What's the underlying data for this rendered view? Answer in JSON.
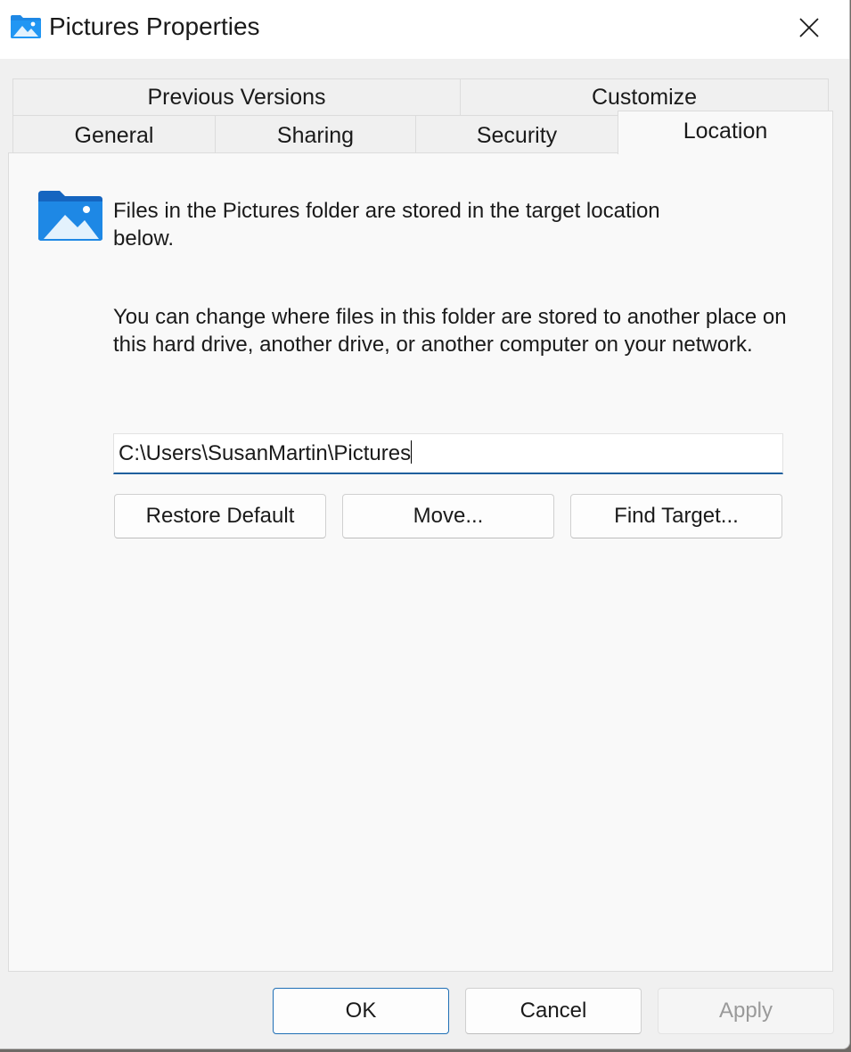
{
  "window": {
    "title": "Pictures Properties",
    "close_icon": "close-icon"
  },
  "tabs": {
    "row1": [
      "Previous Versions",
      "Customize"
    ],
    "row2": [
      "General",
      "Sharing",
      "Security",
      "Location"
    ],
    "selected": "Location"
  },
  "location": {
    "intro": "Files in the Pictures folder are stored in the target location below.",
    "description": "You can change where files in this folder are stored to another place on this hard drive, another drive, or another computer on your network.",
    "path_value": "C:\\Users\\SusanMartin\\Pictures",
    "restore_default_label": "Restore Default",
    "move_label": "Move...",
    "find_target_label": "Find Target..."
  },
  "footer": {
    "ok_label": "OK",
    "cancel_label": "Cancel",
    "apply_label": "Apply"
  },
  "colors": {
    "accent": "#1f6fb5",
    "folder_blue": "#1e88e5",
    "panel_bg": "#f9f9f9",
    "window_bg": "#f0f0f0"
  }
}
